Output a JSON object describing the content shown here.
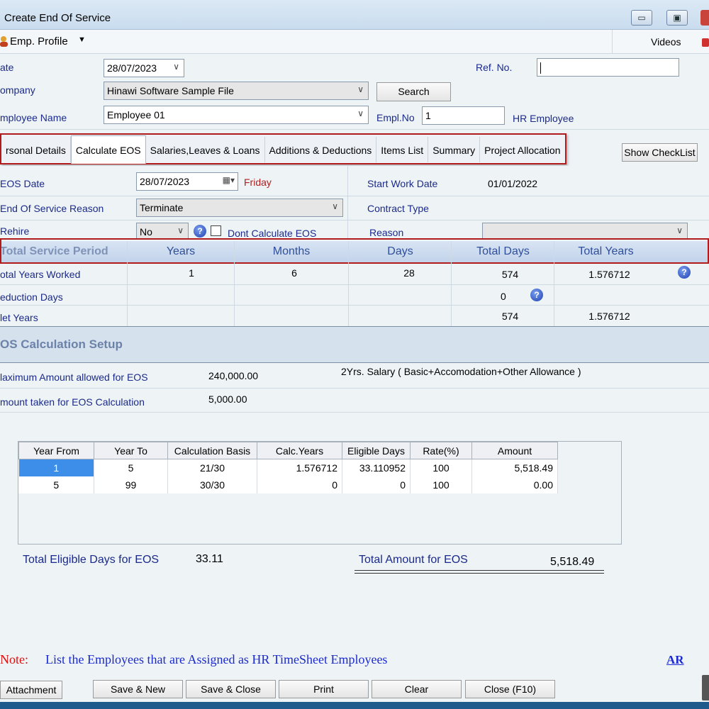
{
  "window": {
    "title": "Create End Of Service",
    "minimize": "▭",
    "restore": "▣"
  },
  "menu": {
    "emp_profile": "Emp. Profile",
    "videos": "Videos"
  },
  "header": {
    "date_label": "ate",
    "date_value": "28/07/2023",
    "ref_label": "Ref. No.",
    "ref_value": "",
    "company_label": "ompany",
    "company_value": "Hinawi Software Sample File",
    "search_label": "Search",
    "employee_label": "mployee Name",
    "employee_value": "Employee 01",
    "emplno_label": "Empl.No",
    "emplno_value": "1",
    "hr_employee": "HR Employee"
  },
  "tabs": [
    "rsonal Details",
    "Calculate EOS",
    "Salaries,Leaves & Loans",
    "Additions & Deductions",
    "Items List",
    "Summary",
    "Project Allocation"
  ],
  "show_checklist": "Show CheckList",
  "eos": {
    "eos_date_label": "EOS Date",
    "eos_date_value": "28/07/2023",
    "eos_day": "Friday",
    "reason_label": "End Of Service Reason",
    "reason_value": "Terminate",
    "rehire_label": "Rehire",
    "rehire_value": "No",
    "dont_calc_label": "Dont Calculate EOS",
    "start_work_label": "Start Work Date",
    "start_work_value": "01/01/2022",
    "contract_type_label": "Contract Type",
    "reason2_label": "Reason",
    "reason2_value": ""
  },
  "service": {
    "headers": [
      "Total Service Period",
      "Years",
      "Months",
      "Days",
      "Total Days",
      "Total Years"
    ],
    "rows": [
      {
        "label": "otal Years Worked",
        "years": "1",
        "months": "6",
        "days": "28",
        "total_days": "574",
        "total_years": "1.576712"
      },
      {
        "label": "eduction Days",
        "years": "",
        "months": "",
        "days": "",
        "total_days": "0",
        "total_years": ""
      },
      {
        "label": "let Years",
        "years": "",
        "months": "",
        "days": "",
        "total_days": "574",
        "total_years": "1.576712"
      }
    ]
  },
  "setup": {
    "title": "OS Calculation Setup",
    "max_label": "laximum Amount allowed for EOS",
    "max_value": "240,000.00",
    "max_note": "2Yrs. Salary ( Basic+Accomodation+Other Allowance )",
    "amount_label": "mount taken for EOS Calculation",
    "amount_value": "5,000.00"
  },
  "calc_table": {
    "headers": [
      "Year From",
      "Year To",
      "Calculation Basis",
      "Calc.Years",
      "Eligible Days",
      "Rate(%)",
      "Amount"
    ],
    "rows": [
      [
        "1",
        "5",
        "21/30",
        "1.576712",
        "33.110952",
        "100",
        "5,518.49"
      ],
      [
        "5",
        "99",
        "30/30",
        "0",
        "0",
        "100",
        "0.00"
      ]
    ]
  },
  "totals": {
    "eligible_label": "Total Eligible Days for EOS",
    "eligible_value": "33.11",
    "amount_label": "Total Amount for EOS",
    "amount_value": "5,518.49"
  },
  "note": {
    "label": "Note:",
    "text": "List the Employees that are Assigned as HR  TimeSheet Employees",
    "ar": "AR"
  },
  "buttons": {
    "attachment": "Attachment",
    "save_new": "Save & New",
    "save_close": "Save & Close",
    "print": "Print",
    "clear": "Clear",
    "close": "Close (F10)"
  }
}
